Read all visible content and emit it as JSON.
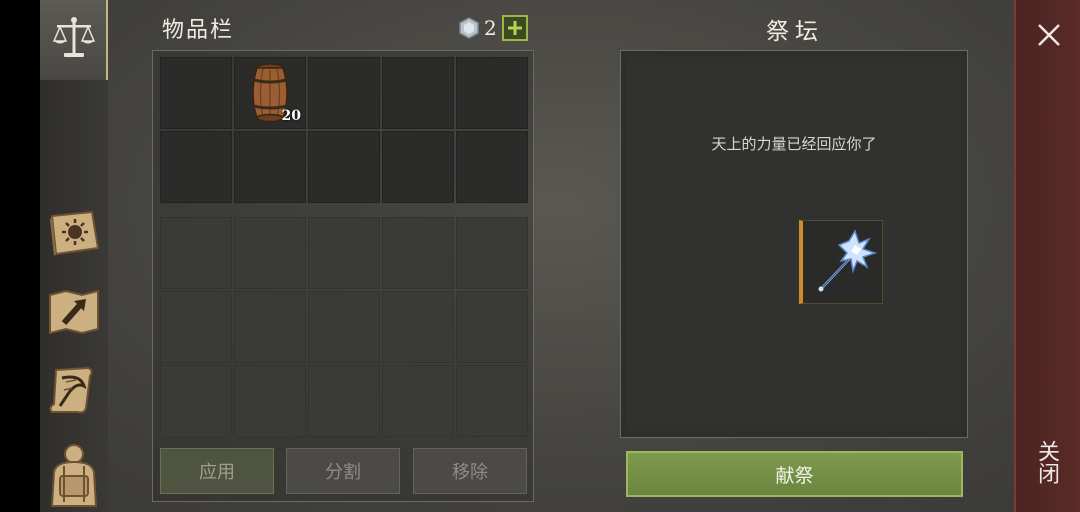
{
  "tabs": [
    {
      "icon": "scales-icon",
      "active": true
    },
    {
      "icon": "sun-book-icon",
      "active": false
    },
    {
      "icon": "map-arrow-icon",
      "active": false
    },
    {
      "icon": "scroll-quill-icon",
      "active": false
    },
    {
      "icon": "backpack-icon",
      "active": false
    }
  ],
  "inventory": {
    "title": "物品栏",
    "gem_count": "2",
    "gem_icon": "gem-icon",
    "plus_icon": "plus-icon",
    "items": [
      {
        "slot": 1,
        "icon": "barrel-icon",
        "quantity": "20"
      }
    ]
  },
  "buttons": {
    "apply": "应用",
    "split": "分割",
    "remove": "移除"
  },
  "altar": {
    "title": "祭坛",
    "message": "天上的力量已经回应你了",
    "slot_item_icon": "ice-mace-icon",
    "offer_label": "献祭"
  },
  "close": {
    "label": "关闭",
    "icon": "close-icon"
  },
  "colors": {
    "accent_green": "#7e9a4c",
    "close_red": "#5a2b27",
    "slot_highlight": "#d08a2a"
  }
}
